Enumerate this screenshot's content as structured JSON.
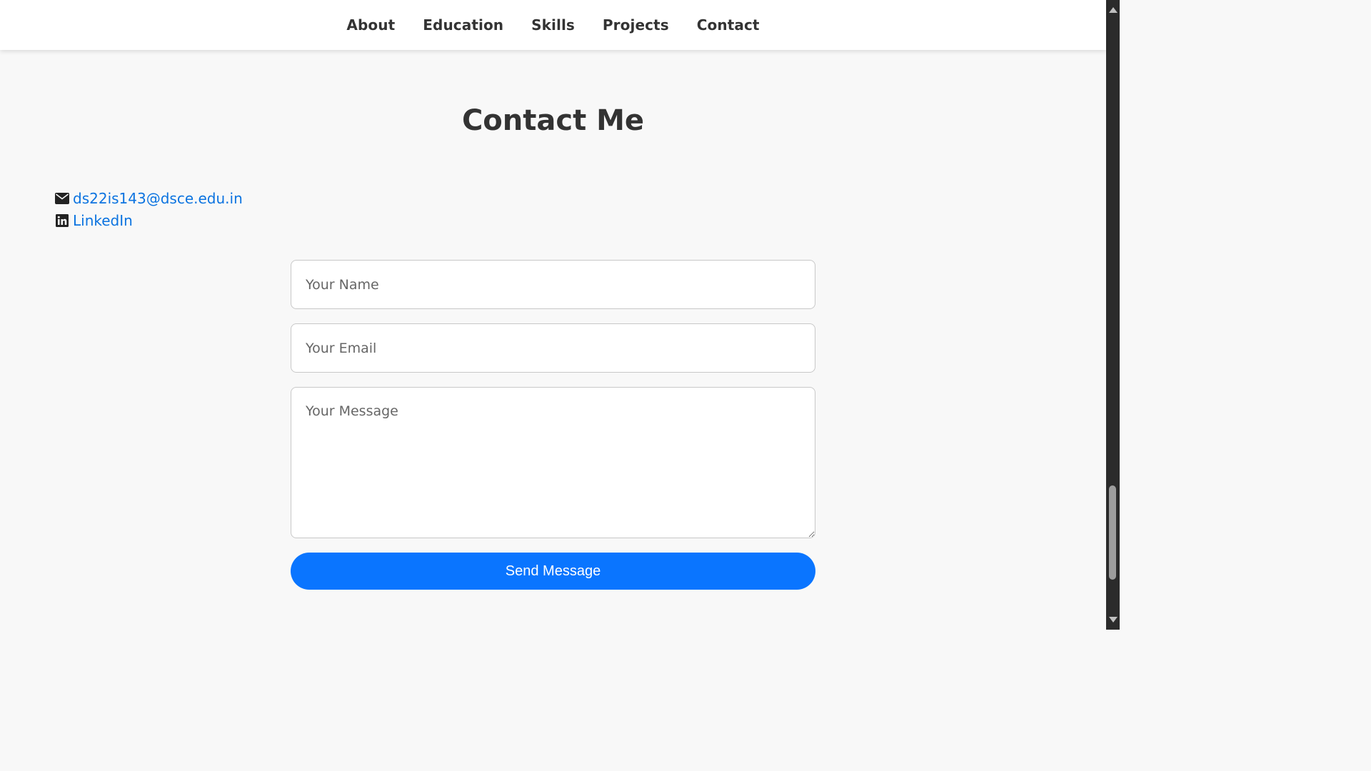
{
  "nav": {
    "items": [
      {
        "label": "About"
      },
      {
        "label": "Education"
      },
      {
        "label": "Skills"
      },
      {
        "label": "Projects"
      },
      {
        "label": "Contact"
      }
    ]
  },
  "section": {
    "title": "Contact Me"
  },
  "contact_info": {
    "email": {
      "text": "ds22is143@dsce.edu.in",
      "icon": "envelope-icon"
    },
    "linkedin": {
      "text": "LinkedIn",
      "icon": "linkedin-icon"
    }
  },
  "form": {
    "name_placeholder": "Your Name",
    "email_placeholder": "Your Email",
    "message_placeholder": "Your Message",
    "submit_label": "Send Message"
  },
  "colors": {
    "accent": "#0a75ff",
    "link": "#0b73e0",
    "text": "#333333",
    "background": "#f8f8f8"
  }
}
